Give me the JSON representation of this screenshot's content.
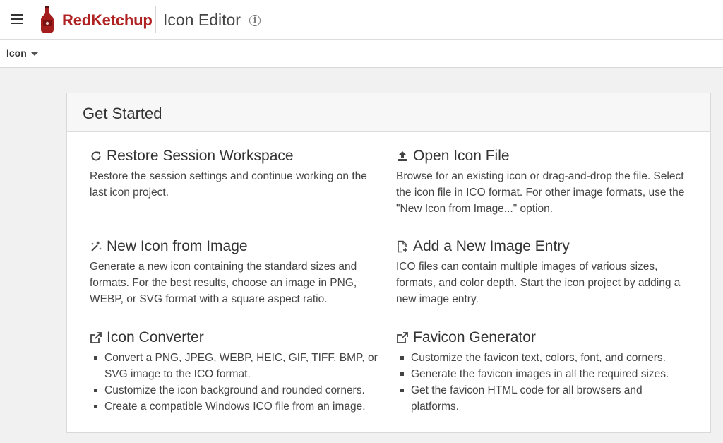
{
  "header": {
    "brand": "RedKetchup",
    "title": "Icon Editor",
    "info_glyph": "i"
  },
  "subbar": {
    "menu_label": "Icon"
  },
  "card": {
    "title": "Get Started",
    "sections": [
      {
        "icon": "refresh-icon",
        "title": "Restore Session Workspace",
        "description": "Restore the session settings and continue working on the last icon project."
      },
      {
        "icon": "upload-icon",
        "title": "Open Icon File",
        "description": "Browse for an existing icon or drag-and-drop the file. Select the icon file in ICO format. For other image formats, use the \"New Icon from Image...\" option."
      },
      {
        "icon": "magic-wand-icon",
        "title": "New Icon from Image",
        "description": "Generate a new icon containing the standard sizes and formats. For the best results, choose an image in PNG, WEBP, or SVG format with a square aspect ratio."
      },
      {
        "icon": "add-file-icon",
        "title": "Add a New Image Entry",
        "description": "ICO files can contain multiple images of various sizes, formats, and color depth. Start the icon project by adding a new image entry."
      },
      {
        "icon": "external-link-icon",
        "title": "Icon Converter",
        "items": [
          "Convert a PNG, JPEG, WEBP, HEIC, GIF, TIFF, BMP, or SVG image to the ICO format.",
          "Customize the icon background and rounded corners.",
          "Create a compatible Windows ICO file from an image."
        ]
      },
      {
        "icon": "external-link-icon",
        "title": "Favicon Generator",
        "items": [
          "Customize the favicon text, colors, font, and corners.",
          "Generate the favicon images in all the required sizes.",
          "Get the favicon HTML code for all browsers and platforms."
        ]
      }
    ]
  },
  "colors": {
    "brand_red": "#b02121",
    "background": "#f1f1f1"
  }
}
